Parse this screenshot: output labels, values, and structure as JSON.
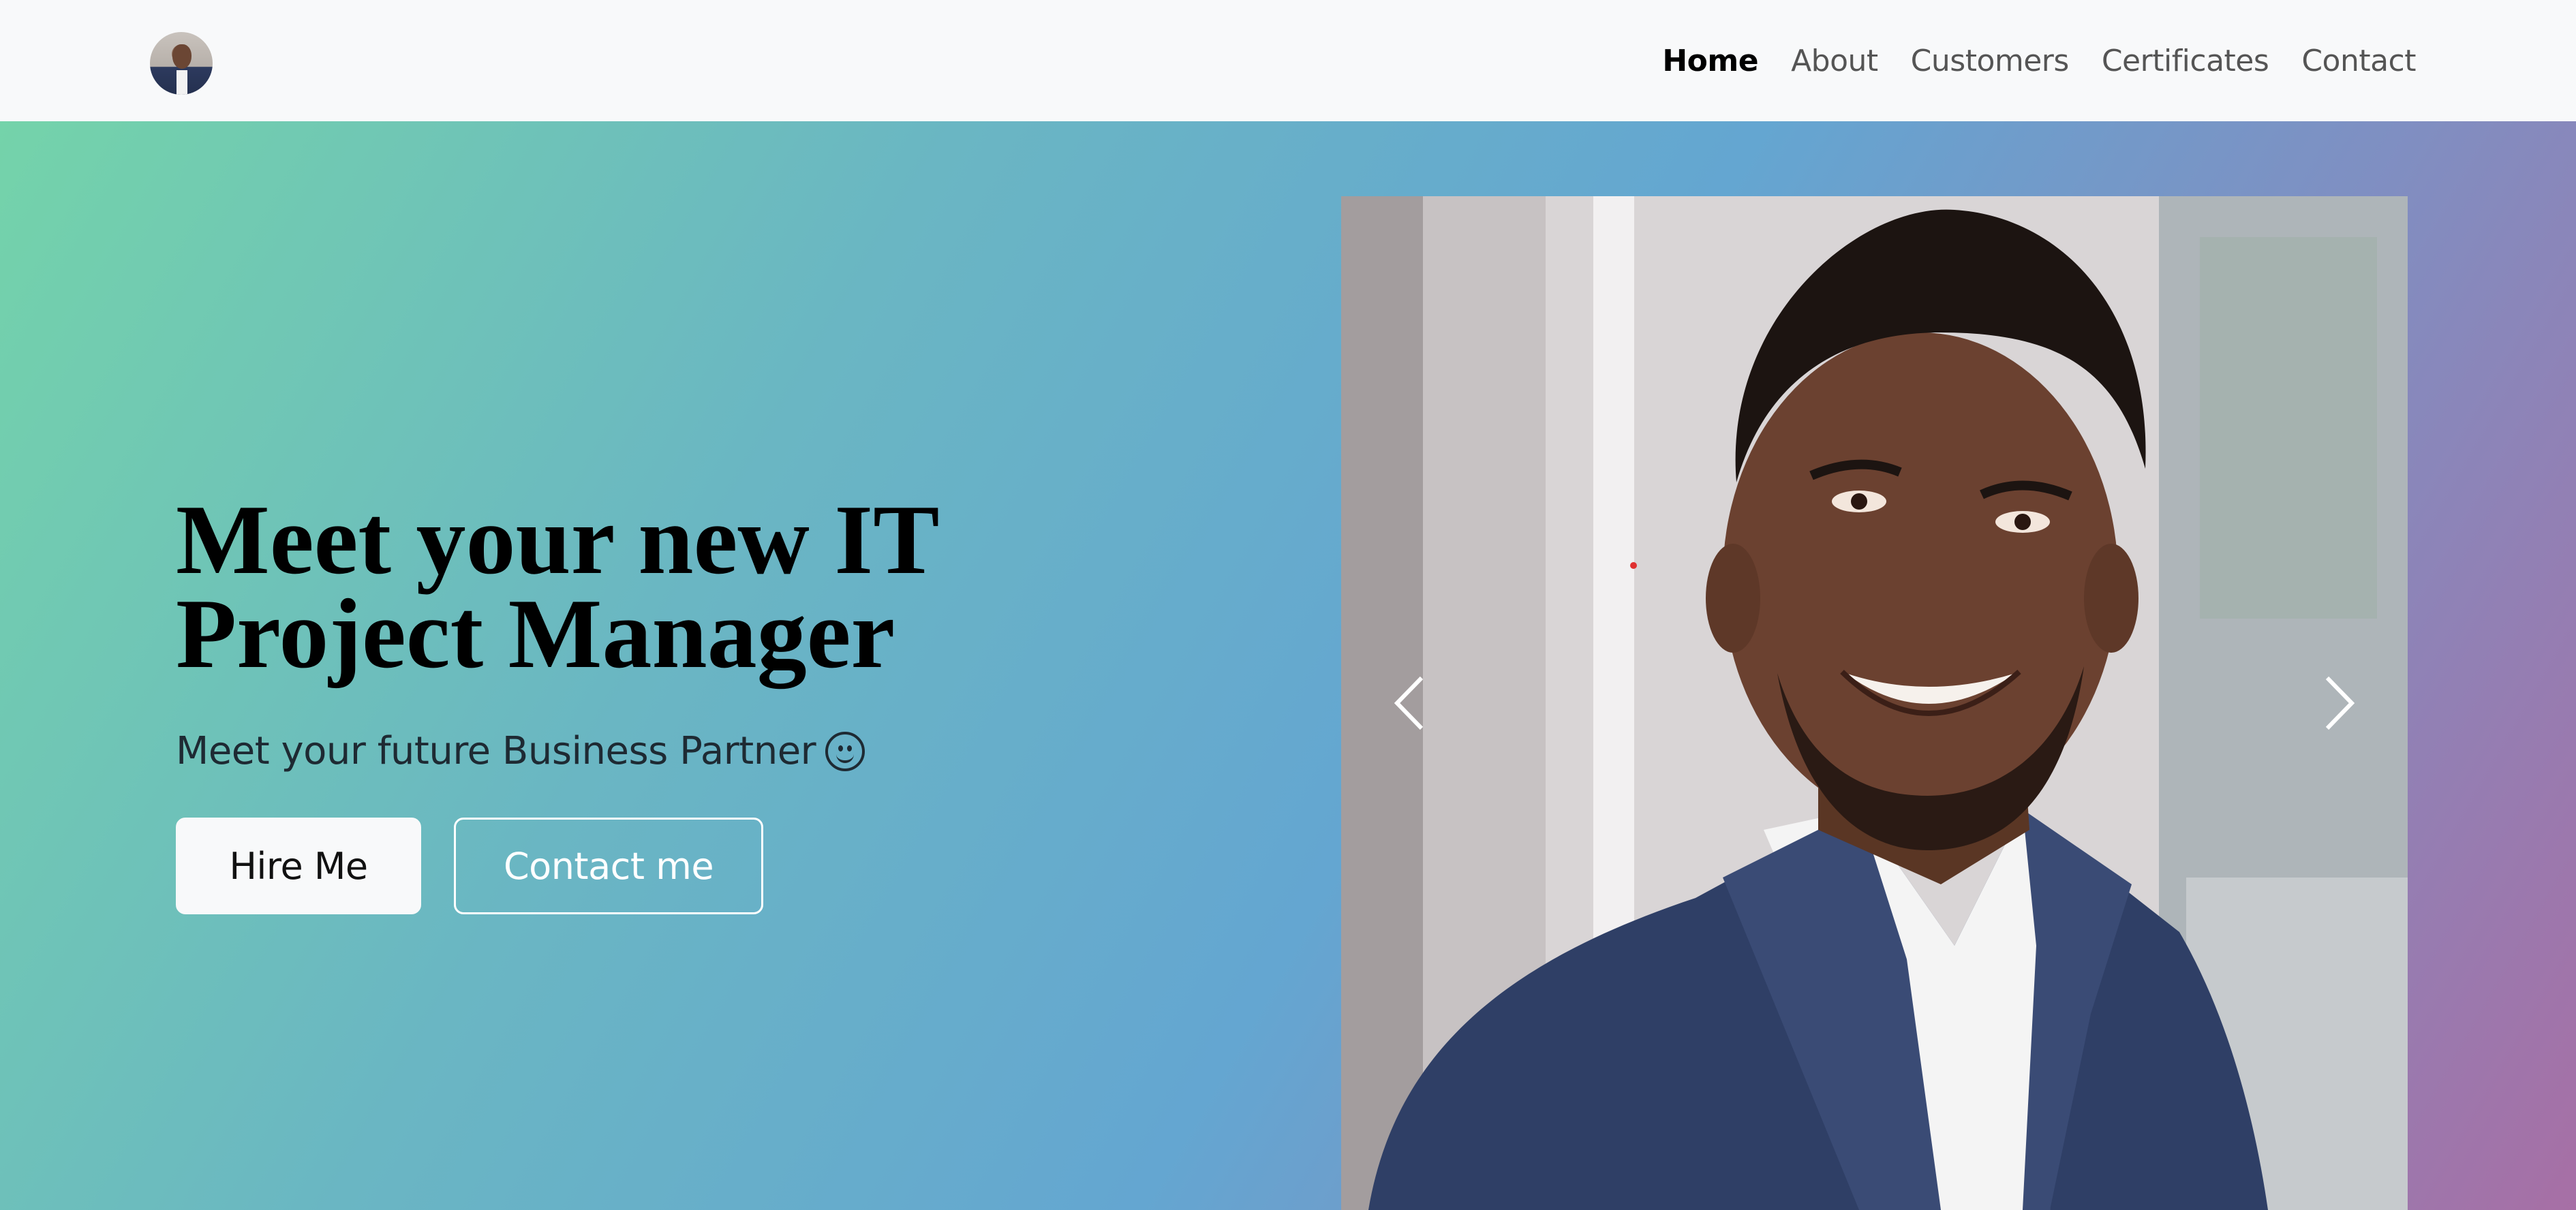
{
  "navbar": {
    "links": [
      "Home",
      "About",
      "Customers",
      "Certificates",
      "Contact"
    ],
    "active": "Home"
  },
  "hero": {
    "headline_line1": "Meet your new IT",
    "headline_line2": "Project Manager",
    "subheadline": "Meet your future Business Partner",
    "hire_button": "Hire Me",
    "contact_button": "Contact me"
  },
  "carousel": {
    "prev_icon": "chevron-left-icon",
    "next_icon": "chevron-right-icon"
  },
  "colors": {
    "nav_bg": "#f8f9fa",
    "gradient_start": "#74d3aa",
    "gradient_mid": "#64a6d1",
    "gradient_end": "#a76fa5"
  }
}
